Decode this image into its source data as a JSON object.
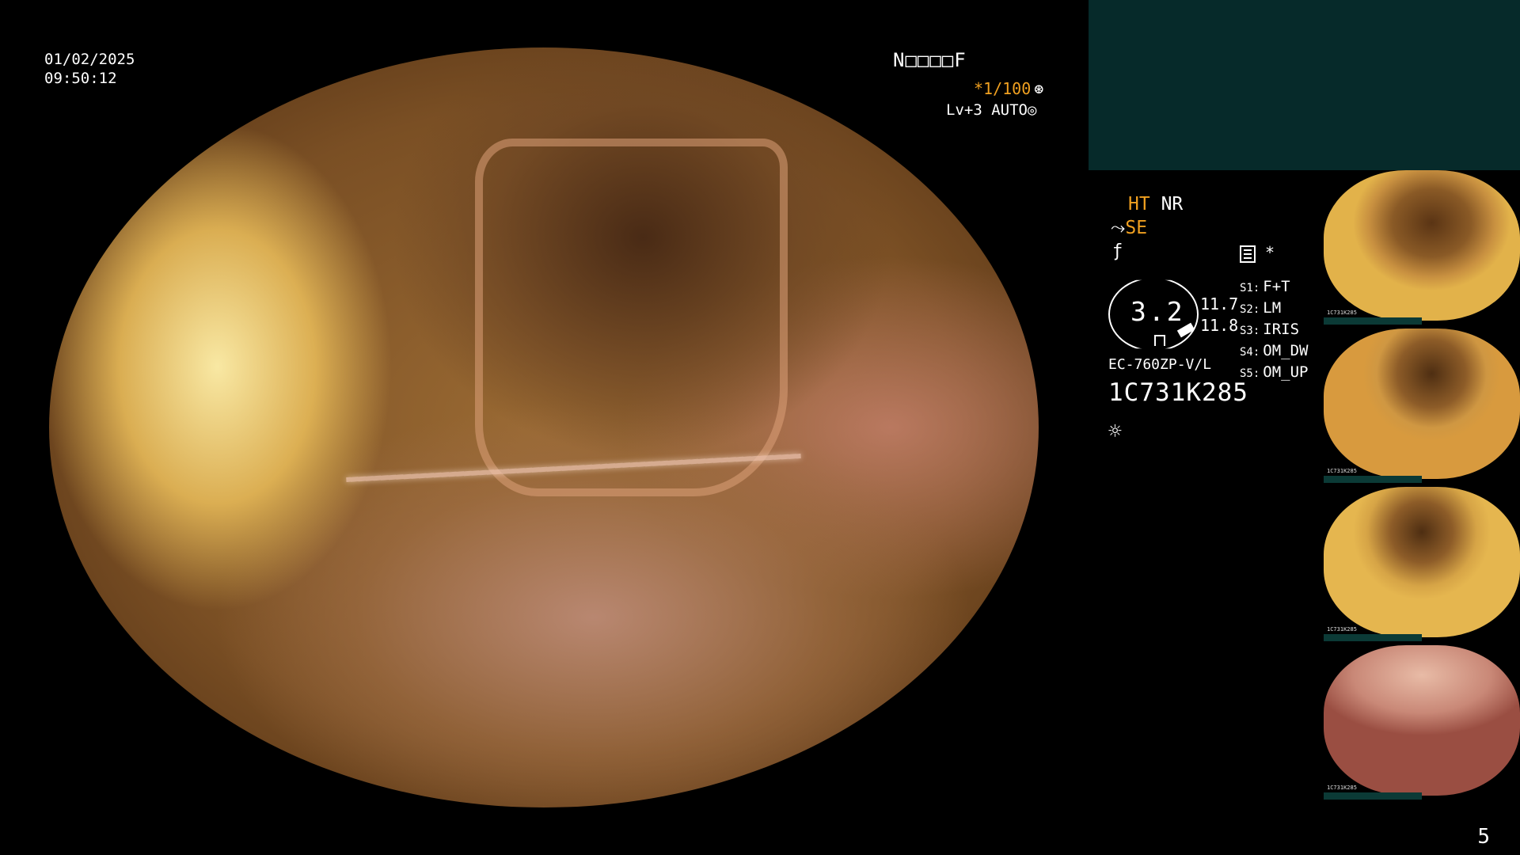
{
  "overlay": {
    "date": "01/02/2025",
    "time": "09:50:12",
    "patient_code": "N□□□□F",
    "shutter": "*1/100",
    "shutter_glyph": "⊛",
    "level": "Lv+3 AUTO",
    "level_glyph": "◎"
  },
  "panel": {
    "mode_ht": "HT",
    "mode_nr": "NR",
    "se_prefix": "⤳",
    "mode_se": "SE",
    "f_glyph": "ƒ",
    "star": "*",
    "gauge_value": "3.2",
    "reading_1": "11.7",
    "reading_2": "11.8",
    "scope_model": "EC-760ZP-V/L",
    "serial": "1C731K285",
    "sun_glyph": "☼",
    "settings": [
      {
        "key": "S1:",
        "value": "F+T"
      },
      {
        "key": "S2:",
        "value": "LM"
      },
      {
        "key": "S3:",
        "value": "IRIS"
      },
      {
        "key": "S4:",
        "value": "OM_DW"
      },
      {
        "key": "S5:",
        "value": "OM_UP"
      }
    ]
  },
  "thumbnails": {
    "serial_label": "1C731K285"
  },
  "page_number": "5"
}
